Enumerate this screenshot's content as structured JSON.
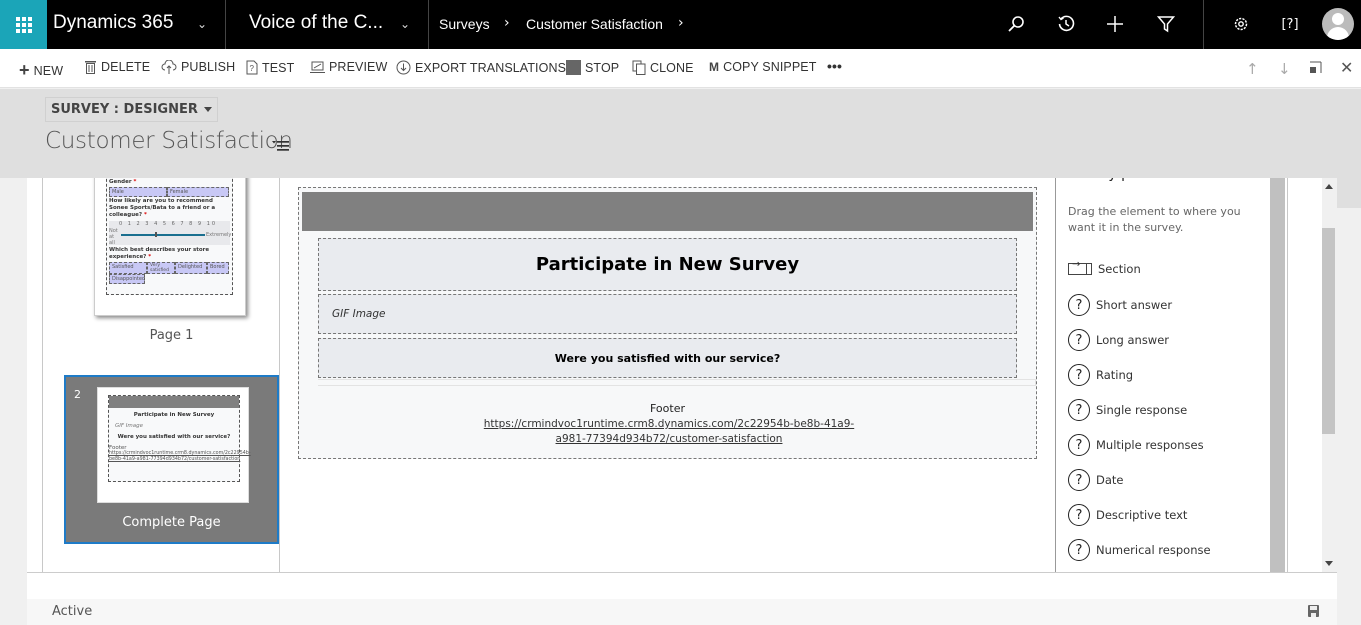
{
  "topbar": {
    "app_name": "Dynamics 365",
    "area_name": "Voice of the C...",
    "breadcrumb": [
      "Surveys",
      "Customer Satisfaction"
    ],
    "icons": [
      "search-icon",
      "recent-icon",
      "new-icon",
      "filter-icon",
      "settings-icon",
      "help-icon",
      "user-avatar"
    ]
  },
  "commands": [
    {
      "label": "NEW",
      "icon": "+"
    },
    {
      "label": "DELETE",
      "icon": "🗑"
    },
    {
      "label": "PUBLISH",
      "icon": "☁"
    },
    {
      "label": "TEST",
      "icon": "?"
    },
    {
      "label": "PREVIEW",
      "icon": "▭"
    },
    {
      "label": "EXPORT TRANSLATIONS",
      "icon": "⇩"
    },
    {
      "label": "STOP",
      "icon": "■"
    },
    {
      "label": "CLONE",
      "icon": "⧉"
    },
    {
      "label": "COPY SNIPPET",
      "icon": "M"
    },
    {
      "label": "•••",
      "icon": ""
    }
  ],
  "record_nav": {
    "up": "↑",
    "down": "↓",
    "popout": "⧉",
    "close": "✕"
  },
  "header": {
    "form_selector": "SURVEY : DESIGNER",
    "record_title": "Customer Satisfaction"
  },
  "pages": [
    {
      "label": "Page 1",
      "thumb": {
        "q1": "Gender",
        "q1_options": [
          "Male",
          "Female"
        ],
        "q2": "How likely are you to recommend Sonee Sports/Bata to a friend or a colleague?",
        "scale": "0 1 2 3 4 5 6 7 8 9 10",
        "scale_low": "Not at all",
        "scale_high": "Extremely",
        "q3": "Which best describes your store experience?",
        "q3_options": [
          "Satisfied",
          "Very satisfied",
          "Delighted",
          "Bored",
          "Disappointed"
        ]
      }
    },
    {
      "number": "2",
      "label": "Complete Page",
      "thumb": {
        "title": "Participate in New Survey",
        "gif": "GIF Image",
        "question": "Were you satisfied with our service?",
        "footer": "Footer",
        "link": "https://crmindvoc1runtime.crm8.dynamics.com/2c22954b-be8b-41a9-a981-77394d934b72/customer-satisfaction"
      }
    }
  ],
  "canvas": {
    "title": "Participate in New Survey",
    "gif": "GIF Image",
    "question": "Were you satisfied with our service?",
    "footer_label": "Footer",
    "footer_link": "https://crmindvoc1runtime.crm8.dynamics.com/2c22954b-be8b-41a9-a981-77394d934b72/customer-satisfaction"
  },
  "survey_parts": {
    "title": "Survey parts",
    "description": "Drag the element to where you want it in the survey.",
    "items": [
      "Section",
      "Short answer",
      "Long answer",
      "Rating",
      "Single response",
      "Multiple responses",
      "Date",
      "Descriptive text",
      "Numerical response"
    ]
  },
  "status": {
    "text": "Active"
  },
  "colors": {
    "waffle": "#1ba5b8",
    "selected_border": "#1e7bc7",
    "banner": "#808080"
  }
}
